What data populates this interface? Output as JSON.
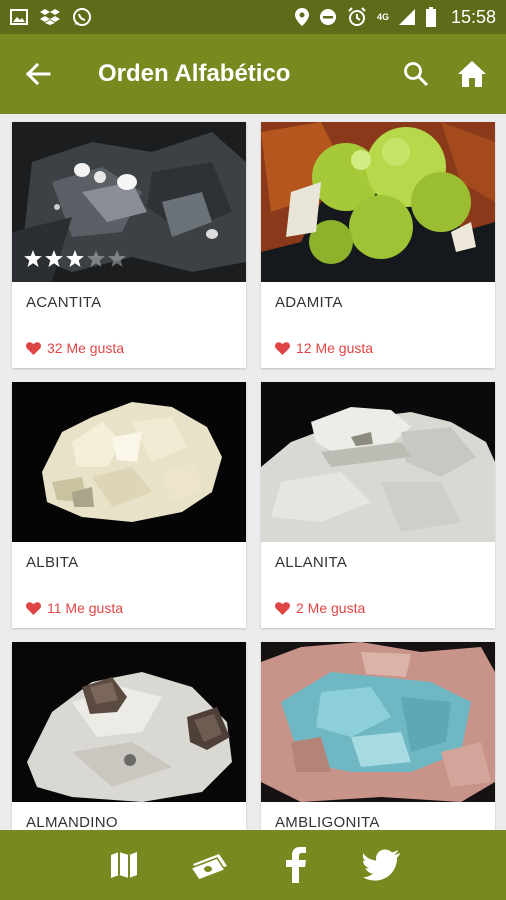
{
  "status_bar": {
    "time": "15:58",
    "network": "4G"
  },
  "app_bar": {
    "title": "Orden Alfabético"
  },
  "cards": [
    {
      "name": "ACANTITA",
      "likes": "32 Me gusta",
      "rating": 3
    },
    {
      "name": "ADAMITA",
      "likes": "12 Me gusta"
    },
    {
      "name": "ALBITA",
      "likes": "11 Me gusta"
    },
    {
      "name": "ALLANITA",
      "likes": "2 Me gusta"
    },
    {
      "name": "ALMANDINO",
      "likes": ""
    },
    {
      "name": "AMBLIGONITA",
      "likes": ""
    }
  ],
  "colors": {
    "primary": "#79891f",
    "status": "#5e6b18",
    "like": "#e04545"
  },
  "icons": [
    "back-arrow-icon",
    "search-icon",
    "home-icon",
    "map-icon",
    "money-icon",
    "facebook-icon",
    "twitter-icon"
  ]
}
